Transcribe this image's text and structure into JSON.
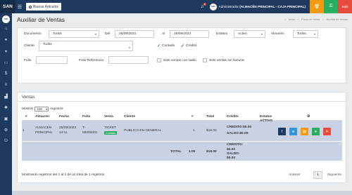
{
  "topbar": {
    "brand": "SAN",
    "search_label": "Buscar Articulos",
    "notif_count": "1",
    "avatar_text": "SAN",
    "user_prefix": "Administrador",
    "user_location": "(ALMACÉN PRINCIPAL - CAJA PRINCIPAL)",
    "red_button_label": "Sale"
  },
  "sidebar": {
    "logo_text": "SAN",
    "icons": [
      "home-icon",
      "user-icon",
      "cart-icon",
      "screen-icon",
      "money-icon",
      "bank-icon",
      "chart-icon",
      "settings-icon",
      "lock-icon",
      "gear-icon",
      "logout-icon"
    ]
  },
  "page": {
    "title": "Auxiliar de Ventas",
    "breadcrumb": [
      "Inicio",
      "Punto de Venta",
      "Auxiliar de Ventas"
    ]
  },
  "filters": {
    "documento_label": "Documento",
    "documento_value": "Todos",
    "del_label": "Del",
    "del_value": "25/09/2023",
    "al_label": "Al",
    "al_value": "25/09/2023",
    "estatus_label": "Estatus",
    "estatus_value": "Activo",
    "almacen_label": "Almacén",
    "almacen_value": "Todos",
    "cliente_label": "Cliente",
    "cliente_value": "Todos",
    "contado_label": "Contado",
    "credito_label": "Crédito",
    "folio_label": "Folio",
    "folio_value": "",
    "folio_ref_label": "Folio Referencia",
    "folio_ref_value": "",
    "solo_saldo_label": "Solo ventas con saldo",
    "solo_sin_facturar_label": "Solo ventas sin facturar"
  },
  "ventas": {
    "header": "Ventas",
    "show_label": "Mostrar",
    "show_value": "100",
    "registros_label": "registros",
    "columns": [
      "#",
      "Almacén",
      "Fecha",
      "Folio",
      "Venta",
      "Cliente",
      "#",
      "Total",
      "Crédito",
      "Estatus"
    ],
    "row": {
      "num": "1",
      "almacen_1": "ALMACEN",
      "almacen_2": "PRINCIPAL",
      "fecha_1": "25/09/2023",
      "fecha_2": "14:11",
      "folio_1": "T-",
      "folio_2": "00000001",
      "venta": "TICKET",
      "venta_badge": "Contado",
      "cliente": "PUBLICO EN GENERAL",
      "cantidad": "1",
      "total": "$18.00",
      "credito_1": "CREDITO:$0.00",
      "saldo_1": "SALDO:$0.00",
      "estatus": "ACTIVO"
    },
    "footer": {
      "total_label": "TOTAL",
      "cantidad": "1.00",
      "total": "$18.00",
      "credito": "CREDITO:",
      "credito_val": "$0.00",
      "saldo": "SALDO:",
      "saldo_val": "$0.00"
    },
    "info": "Mostrando registros del 1 al 1 de un total de 1 registros",
    "prev": "Anterior",
    "page": "1",
    "next": "Siguiente"
  },
  "colors": {
    "navy": "#1e3a5f",
    "row_bg": "#c9d1e4",
    "orange": "#f39c12",
    "green": "#27ae60",
    "red": "#e74c3c",
    "blue": "#3498db",
    "dark": "#1e3a5f"
  }
}
